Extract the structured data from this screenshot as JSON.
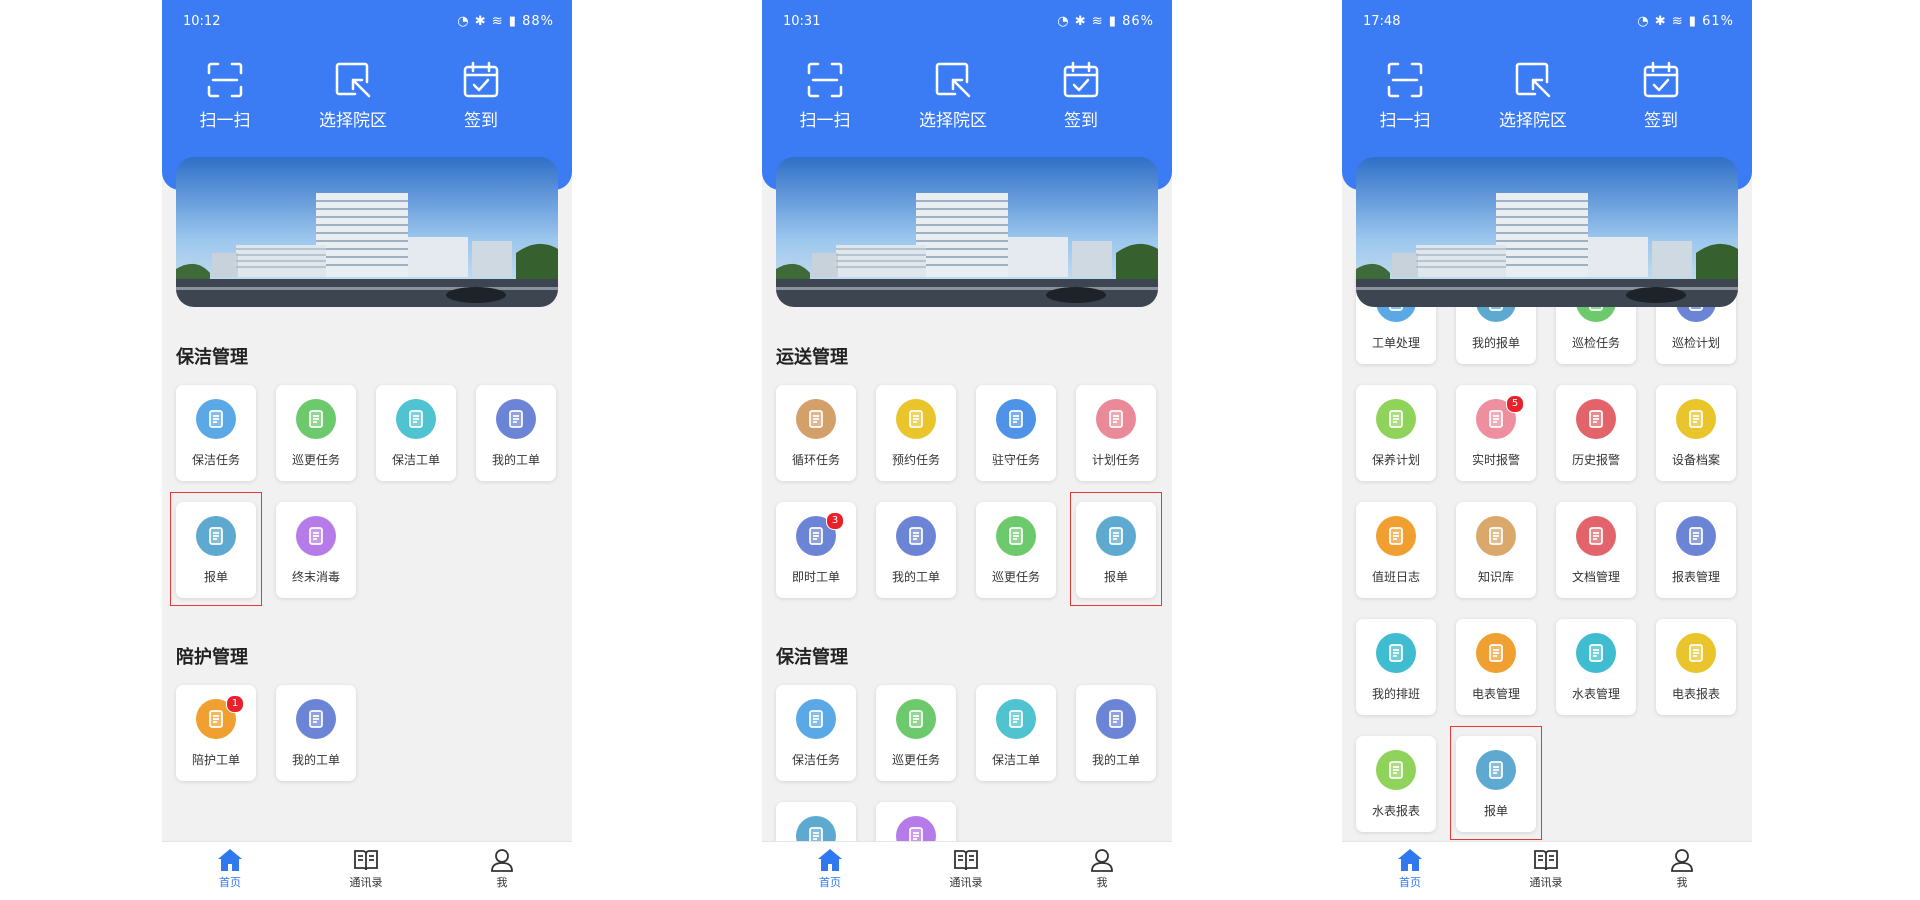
{
  "colors": {
    "primary": "#3b7cf5",
    "badge": "#e8222b",
    "highlight": "#e53935"
  },
  "quick_actions": [
    {
      "label": "扫一扫",
      "icon": "scan-icon"
    },
    {
      "label": "选择院区",
      "icon": "select-area-icon"
    },
    {
      "label": "签到",
      "icon": "checkin-calendar-icon"
    }
  ],
  "tabs": [
    {
      "label": "首页",
      "icon": "home-icon"
    },
    {
      "label": "通讯录",
      "icon": "contacts-book-icon"
    },
    {
      "label": "我",
      "icon": "user-icon"
    }
  ],
  "phones": [
    {
      "status": {
        "time": "10:12",
        "battery": "88%"
      },
      "sections": [
        {
          "title": "保洁管理",
          "items": [
            {
              "label": "保洁任务",
              "icon": "cleaning-task-icon",
              "color": "#5aa9e6"
            },
            {
              "label": "巡更任务",
              "icon": "patrol-task-icon",
              "color": "#6cc96c"
            },
            {
              "label": "保洁工单",
              "icon": "cleaning-order-icon",
              "color": "#4fc3d0"
            },
            {
              "label": "我的工单",
              "icon": "my-order-icon",
              "color": "#6b84d6"
            },
            {
              "label": "报单",
              "icon": "report-icon",
              "color": "#5ea9cf",
              "highlighted": true
            },
            {
              "label": "终末消毒",
              "icon": "disinfect-icon",
              "color": "#b57be8"
            }
          ]
        },
        {
          "title": "陪护管理",
          "items": [
            {
              "label": "陪护工单",
              "icon": "escort-order-icon",
              "color": "#f0a030",
              "badge": "1"
            },
            {
              "label": "我的工单",
              "icon": "my-order-icon",
              "color": "#6b84d6"
            }
          ]
        }
      ]
    },
    {
      "status": {
        "time": "10:31",
        "battery": "86%"
      },
      "sections": [
        {
          "title": "运送管理",
          "items": [
            {
              "label": "循环任务",
              "icon": "cycle-task-icon",
              "color": "#d4a06a"
            },
            {
              "label": "预约任务",
              "icon": "appointment-task-icon",
              "color": "#e9c42a"
            },
            {
              "label": "驻守任务",
              "icon": "guard-task-icon",
              "color": "#4f93e8"
            },
            {
              "label": "计划任务",
              "icon": "plan-task-icon",
              "color": "#ea8a99"
            },
            {
              "label": "即时工单",
              "icon": "instant-order-icon",
              "color": "#6b84d6",
              "badge": "3"
            },
            {
              "label": "我的工单",
              "icon": "my-order-icon",
              "color": "#6b84d6"
            },
            {
              "label": "巡更任务",
              "icon": "patrol-task-icon",
              "color": "#6cc96c"
            },
            {
              "label": "报单",
              "icon": "report-icon",
              "color": "#5ea9cf",
              "highlighted": true
            }
          ]
        },
        {
          "title": "保洁管理",
          "items": [
            {
              "label": "保洁任务",
              "icon": "cleaning-task-icon",
              "color": "#5aa9e6"
            },
            {
              "label": "巡更任务",
              "icon": "patrol-task-icon",
              "color": "#6cc96c"
            },
            {
              "label": "保洁工单",
              "icon": "cleaning-order-icon",
              "color": "#4fc3d0"
            },
            {
              "label": "我的工单",
              "icon": "my-order-icon",
              "color": "#6b84d6"
            },
            {
              "label": "",
              "icon": "report-icon",
              "color": "#5ea9cf"
            },
            {
              "label": "",
              "icon": "disinfect-icon",
              "color": "#b57be8"
            }
          ]
        }
      ]
    },
    {
      "status": {
        "time": "17:48",
        "battery": "61%"
      },
      "sections": [
        {
          "title": "",
          "items": [
            {
              "label": "工单处理",
              "icon": "order-process-icon",
              "color": "#5aa9e6"
            },
            {
              "label": "我的报单",
              "icon": "my-report-icon",
              "color": "#5ea9cf"
            },
            {
              "label": "巡检任务",
              "icon": "inspection-task-icon",
              "color": "#6cc96c"
            },
            {
              "label": "巡检计划",
              "icon": "inspection-plan-icon",
              "color": "#6b84d6"
            },
            {
              "label": "保养计划",
              "icon": "maintenance-plan-icon",
              "color": "#8fd35a"
            },
            {
              "label": "实时报警",
              "icon": "realtime-alarm-icon",
              "color": "#ee8fa0",
              "badge": "5"
            },
            {
              "label": "历史报警",
              "icon": "history-alarm-icon",
              "color": "#e2636a"
            },
            {
              "label": "设备档案",
              "icon": "device-archive-icon",
              "color": "#e9c42a"
            },
            {
              "label": "值班日志",
              "icon": "duty-log-icon",
              "color": "#f0a030"
            },
            {
              "label": "知识库",
              "icon": "knowledge-base-icon",
              "color": "#d9a86a"
            },
            {
              "label": "文档管理",
              "icon": "document-manage-icon",
              "color": "#e2636a"
            },
            {
              "label": "报表管理",
              "icon": "report-manage-icon",
              "color": "#6b84d6"
            },
            {
              "label": "我的排班",
              "icon": "schedule-icon",
              "color": "#3fbcd0"
            },
            {
              "label": "电表管理",
              "icon": "electric-meter-icon",
              "color": "#f0a030"
            },
            {
              "label": "水表管理",
              "icon": "water-meter-icon",
              "color": "#3fbcd0"
            },
            {
              "label": "电表报表",
              "icon": "electric-report-icon",
              "color": "#e9c42a"
            },
            {
              "label": "水表报表",
              "icon": "water-report-icon",
              "color": "#8fd35a"
            },
            {
              "label": "报单",
              "icon": "report-icon",
              "color": "#5ea9cf",
              "highlighted": true
            }
          ]
        }
      ]
    }
  ]
}
